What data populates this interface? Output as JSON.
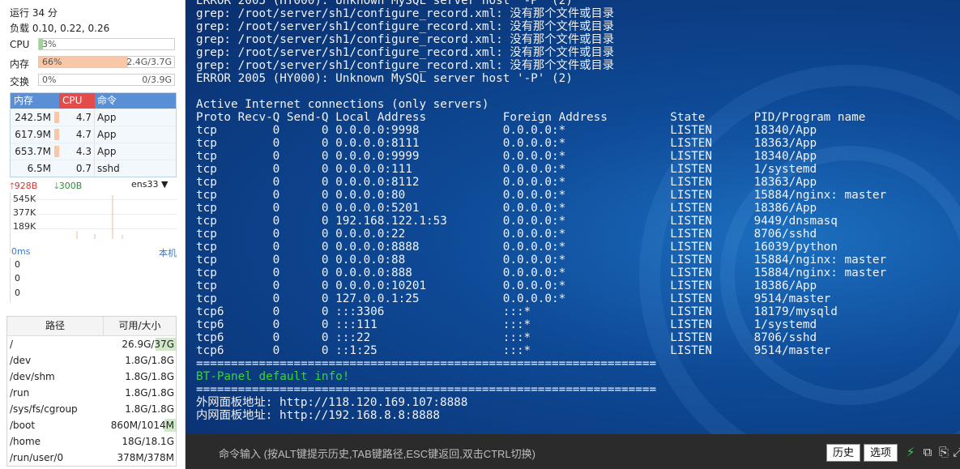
{
  "sidebar": {
    "uptime": "运行 34 分",
    "load": "负载 0.10, 0.22, 0.26",
    "cpu": {
      "label": "CPU",
      "pct_text": "3%",
      "fraction": 0.03
    },
    "mem": {
      "label": "内存",
      "pct_text": "66%",
      "amount": "2.4G/3.7G",
      "fraction": 0.66
    },
    "swap": {
      "label": "交换",
      "pct_text": "0%",
      "amount": "0/3.9G",
      "fraction": 0.0
    },
    "proc_headers": {
      "mem": "内存",
      "cpu": "CPU",
      "cmd": "命令"
    },
    "processes": [
      {
        "mem": "242.5M",
        "cpu": "4.7",
        "cmd": "App"
      },
      {
        "mem": "617.9M",
        "cpu": "4.7",
        "cmd": "App"
      },
      {
        "mem": "653.7M",
        "cpu": "4.3",
        "cmd": "App"
      },
      {
        "mem": "6.5M",
        "cpu": "0.7",
        "cmd": "sshd"
      }
    ],
    "net": {
      "up": "928B",
      "down": "300B",
      "iface": "ens33",
      "scale": [
        "545K",
        "377K",
        "189K"
      ]
    },
    "latency": {
      "ms": "0ms",
      "host": "本机",
      "values": [
        "0",
        "0",
        "0"
      ]
    },
    "disk_headers": {
      "path": "路径",
      "size": "可用/大小"
    },
    "disks": [
      {
        "path": "/",
        "size": "26.9G/37G",
        "used": 0.27
      },
      {
        "path": "/dev",
        "size": "1.8G/1.8G",
        "used": 0.0
      },
      {
        "path": "/dev/shm",
        "size": "1.8G/1.8G",
        "used": 0.0
      },
      {
        "path": "/run",
        "size": "1.8G/1.8G",
        "used": 0.0
      },
      {
        "path": "/sys/fs/cgroup",
        "size": "1.8G/1.8G",
        "used": 0.0
      },
      {
        "path": "/boot",
        "size": "860M/1014M",
        "used": 0.15
      },
      {
        "path": "/home",
        "size": "18G/18.1G",
        "used": 0.0
      },
      {
        "path": "/run/user/0",
        "size": "378M/378M",
        "used": 0.0
      }
    ]
  },
  "terminal": {
    "lines": [
      {
        "text": "ERROR 2005 (HY000): Unknown MySQL server host '-P' (2)"
      },
      {
        "text": "grep: /root/server/sh1/configure_record.xml: 没有那个文件或目录"
      },
      {
        "text": "grep: /root/server/sh1/configure_record.xml: 没有那个文件或目录"
      },
      {
        "text": "grep: /root/server/sh1/configure_record.xml: 没有那个文件或目录"
      },
      {
        "text": "grep: /root/server/sh1/configure_record.xml: 没有那个文件或目录"
      },
      {
        "text": "grep: /root/server/sh1/configure_record.xml: 没有那个文件或目录"
      },
      {
        "text": "ERROR 2005 (HY000): Unknown MySQL server host '-P' (2)"
      },
      {
        "text": ""
      },
      {
        "text": "Active Internet connections (only servers)"
      },
      {
        "text": "Proto Recv-Q Send-Q Local Address           Foreign Address         State       PID/Program name"
      },
      {
        "text": "tcp        0      0 0.0.0.0:9998            0.0.0.0:*               LISTEN      18340/App"
      },
      {
        "text": "tcp        0      0 0.0.0.0:8111            0.0.0.0:*               LISTEN      18363/App"
      },
      {
        "text": "tcp        0      0 0.0.0.0:9999            0.0.0.0:*               LISTEN      18340/App"
      },
      {
        "text": "tcp        0      0 0.0.0.0:111             0.0.0.0:*               LISTEN      1/systemd"
      },
      {
        "text": "tcp        0      0 0.0.0.0:8112            0.0.0.0:*               LISTEN      18363/App"
      },
      {
        "text": "tcp        0      0 0.0.0.0:80              0.0.0.0:*               LISTEN      15884/nginx: master"
      },
      {
        "text": "tcp        0      0 0.0.0.0:5201            0.0.0.0:*               LISTEN      18386/App"
      },
      {
        "text": "tcp        0      0 192.168.122.1:53        0.0.0.0:*               LISTEN      9449/dnsmasq"
      },
      {
        "text": "tcp        0      0 0.0.0.0:22              0.0.0.0:*               LISTEN      8706/sshd"
      },
      {
        "text": "tcp        0      0 0.0.0.0:8888            0.0.0.0:*               LISTEN      16039/python"
      },
      {
        "text": "tcp        0      0 0.0.0.0:88              0.0.0.0:*               LISTEN      15884/nginx: master"
      },
      {
        "text": "tcp        0      0 0.0.0.0:888             0.0.0.0:*               LISTEN      15884/nginx: master"
      },
      {
        "text": "tcp        0      0 0.0.0.0:10201           0.0.0.0:*               LISTEN      18386/App"
      },
      {
        "text": "tcp        0      0 127.0.0.1:25            0.0.0.0:*               LISTEN      9514/master"
      },
      {
        "text": "tcp6       0      0 :::3306                 :::*                    LISTEN      18179/mysqld"
      },
      {
        "text": "tcp6       0      0 :::111                  :::*                    LISTEN      1/systemd"
      },
      {
        "text": "tcp6       0      0 :::22                   :::*                    LISTEN      8706/sshd"
      },
      {
        "text": "tcp6       0      0 ::1:25                  :::*                    LISTEN      9514/master"
      },
      {
        "text": "=================================================================="
      },
      {
        "text": "BT-Panel default info!",
        "green": true
      },
      {
        "text": "=================================================================="
      },
      {
        "text": "外网面板地址: http://118.120.169.107:8888"
      },
      {
        "text": "内网面板地址: http://192.168.8.8:8888"
      }
    ]
  },
  "input_bar": {
    "hint": "命令输入 (按ALT键提示历史,TAB键路径,ESC键返回,双击CTRL切换)",
    "history_label": "历史",
    "options_label": "选项",
    "icons": [
      "lightning-icon",
      "copy-icon",
      "paste-icon",
      "expand-icon"
    ]
  },
  "colors": {
    "mem_bar": "#f8c7a7",
    "cpu_bar": "#9fd29a",
    "cpu_header": "#e44c4c",
    "proc_header": "#5a8fd6",
    "terminal_green": "#36d636"
  }
}
